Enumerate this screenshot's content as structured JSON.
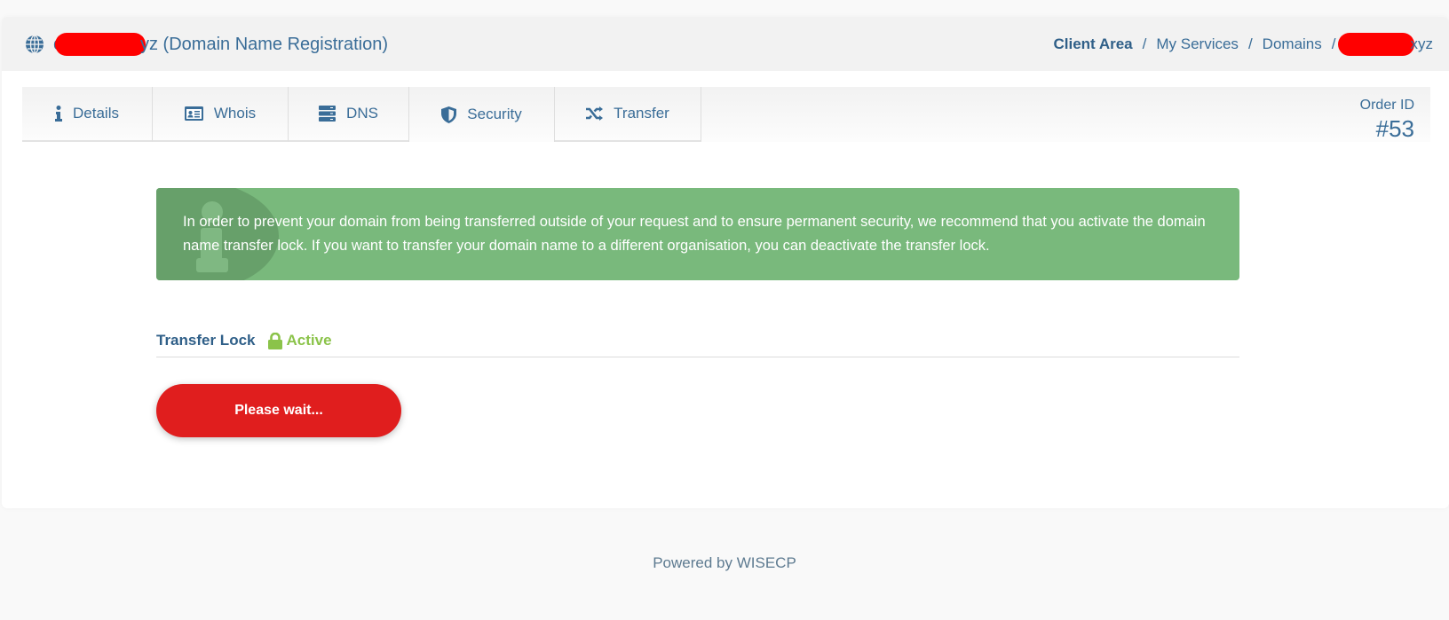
{
  "header": {
    "title_prefix": "c",
    "title_suffix": "yz (Domain Name Registration)",
    "icon": "globe-icon"
  },
  "breadcrumb": {
    "items": [
      "Client Area",
      "My Services",
      "Domains"
    ],
    "separator": "/",
    "current_suffix": "xyz"
  },
  "tabs": [
    {
      "label": "Details",
      "icon": "info-icon"
    },
    {
      "label": "Whois",
      "icon": "id-card-icon"
    },
    {
      "label": "DNS",
      "icon": "server-icon"
    },
    {
      "label": "Security",
      "icon": "shield-icon",
      "active": true
    },
    {
      "label": "Transfer",
      "icon": "shuffle-icon"
    }
  ],
  "order": {
    "label": "Order ID",
    "value": "#53"
  },
  "alert": {
    "text": "In order to prevent your domain from being transferred outside of your request and to ensure permanent security, we recommend that you activate the domain name transfer lock. If you want to transfer your domain name to a different organisation, you can deactivate the transfer lock.",
    "color": "#79b97c"
  },
  "transfer_lock": {
    "label": "Transfer Lock",
    "status": "Active",
    "status_color": "#8bc34a"
  },
  "action_button": {
    "label": "Please wait...",
    "color": "#e01e1e"
  },
  "footer": {
    "text": "Powered by WISECP"
  }
}
